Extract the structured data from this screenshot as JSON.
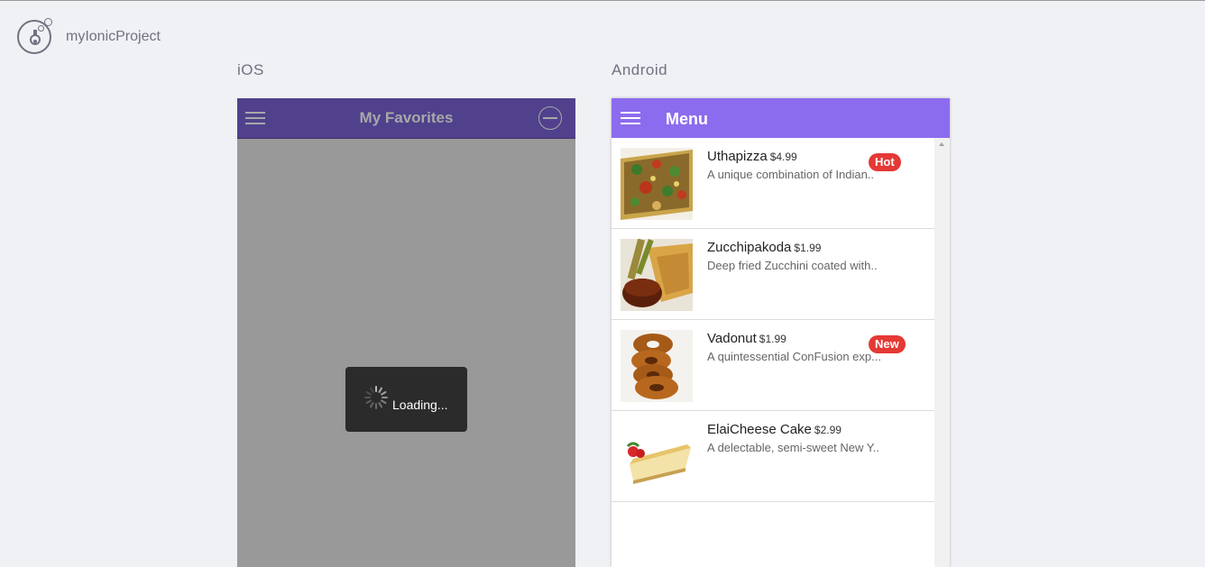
{
  "app": {
    "title": "myIonicProject"
  },
  "platforms": {
    "ios_label": "iOS",
    "android_label": "Android"
  },
  "ios": {
    "toolbar_title": "My Favorites",
    "loading_text": "Loading..."
  },
  "android": {
    "toolbar_title": "Menu",
    "items": [
      {
        "name": "Uthapizza",
        "price": "$4.99",
        "description": "A unique combination of Indian..",
        "badge": "Hot"
      },
      {
        "name": "Zucchipakoda",
        "price": "$1.99",
        "description": "Deep fried Zucchini coated with..",
        "badge": ""
      },
      {
        "name": "Vadonut",
        "price": "$1.99",
        "description": "A quintessential ConFusion exp...",
        "badge": "New"
      },
      {
        "name": "ElaiCheese Cake",
        "price": "$2.99",
        "description": "A delectable, semi-sweet New Y..",
        "badge": ""
      }
    ]
  },
  "colors": {
    "ios_toolbar": "#51418d",
    "android_toolbar": "#8c6cee",
    "badge": "#e53935"
  }
}
